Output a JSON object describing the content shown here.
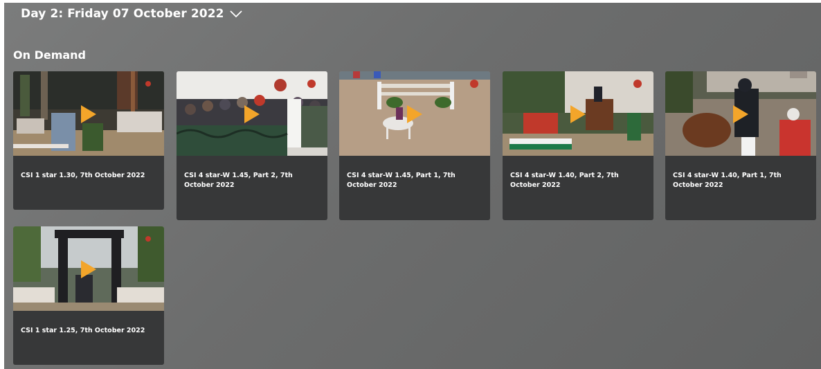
{
  "day_header": {
    "label": "Day 2: Friday 07 October 2022"
  },
  "section": {
    "title": "On Demand"
  },
  "accent_color": "#f3a52a",
  "card_color": "#373839",
  "videos": [
    {
      "title": "CSI 1 star 1.30, 7th October 2022"
    },
    {
      "title": "CSI 4 star-W 1.45, Part 2, 7th October 2022"
    },
    {
      "title": "CSI 4 star-W 1.45, Part 1, 7th October 2022"
    },
    {
      "title": "CSI 4 star-W 1.40, Part 2, 7th October 2022"
    },
    {
      "title": "CSI 4 star-W 1.40, Part 1, 7th October 2022"
    },
    {
      "title": "CSI 1 star 1.25, 7th October 2022"
    }
  ]
}
